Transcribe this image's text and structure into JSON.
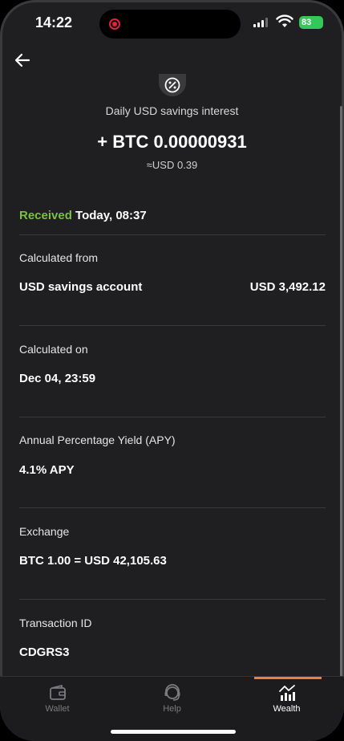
{
  "status_bar": {
    "time": "14:22",
    "battery": "83"
  },
  "header": {
    "title": "Daily USD savings interest",
    "amount": "+ BTC 0.00000931",
    "fiat_equivalent": "≈USD 0.39"
  },
  "status": {
    "state": "Received",
    "time": "Today, 08:37"
  },
  "details": {
    "calculated_from": {
      "label": "Calculated from",
      "account": "USD savings account",
      "balance": "USD 3,492.12"
    },
    "calculated_on": {
      "label": "Calculated on",
      "value": "Dec 04, 23:59"
    },
    "apy": {
      "label": "Annual Percentage Yield (APY)",
      "value": "4.1% APY"
    },
    "exchange": {
      "label": "Exchange",
      "value": "BTC 1.00 = USD 42,105.63"
    },
    "transaction": {
      "label": "Transaction ID",
      "value": "CDGRS3"
    }
  },
  "tabbar": {
    "tabs": [
      {
        "label": "Wallet",
        "icon": "wallet-icon"
      },
      {
        "label": "Help",
        "icon": "headset-icon"
      },
      {
        "label": "Wealth",
        "icon": "chart-icon"
      }
    ],
    "active": "Wealth"
  },
  "colors": {
    "received": "#7ac143",
    "accent": "#ef7d3c",
    "battery": "#34c759",
    "recording": "#e0243a"
  }
}
